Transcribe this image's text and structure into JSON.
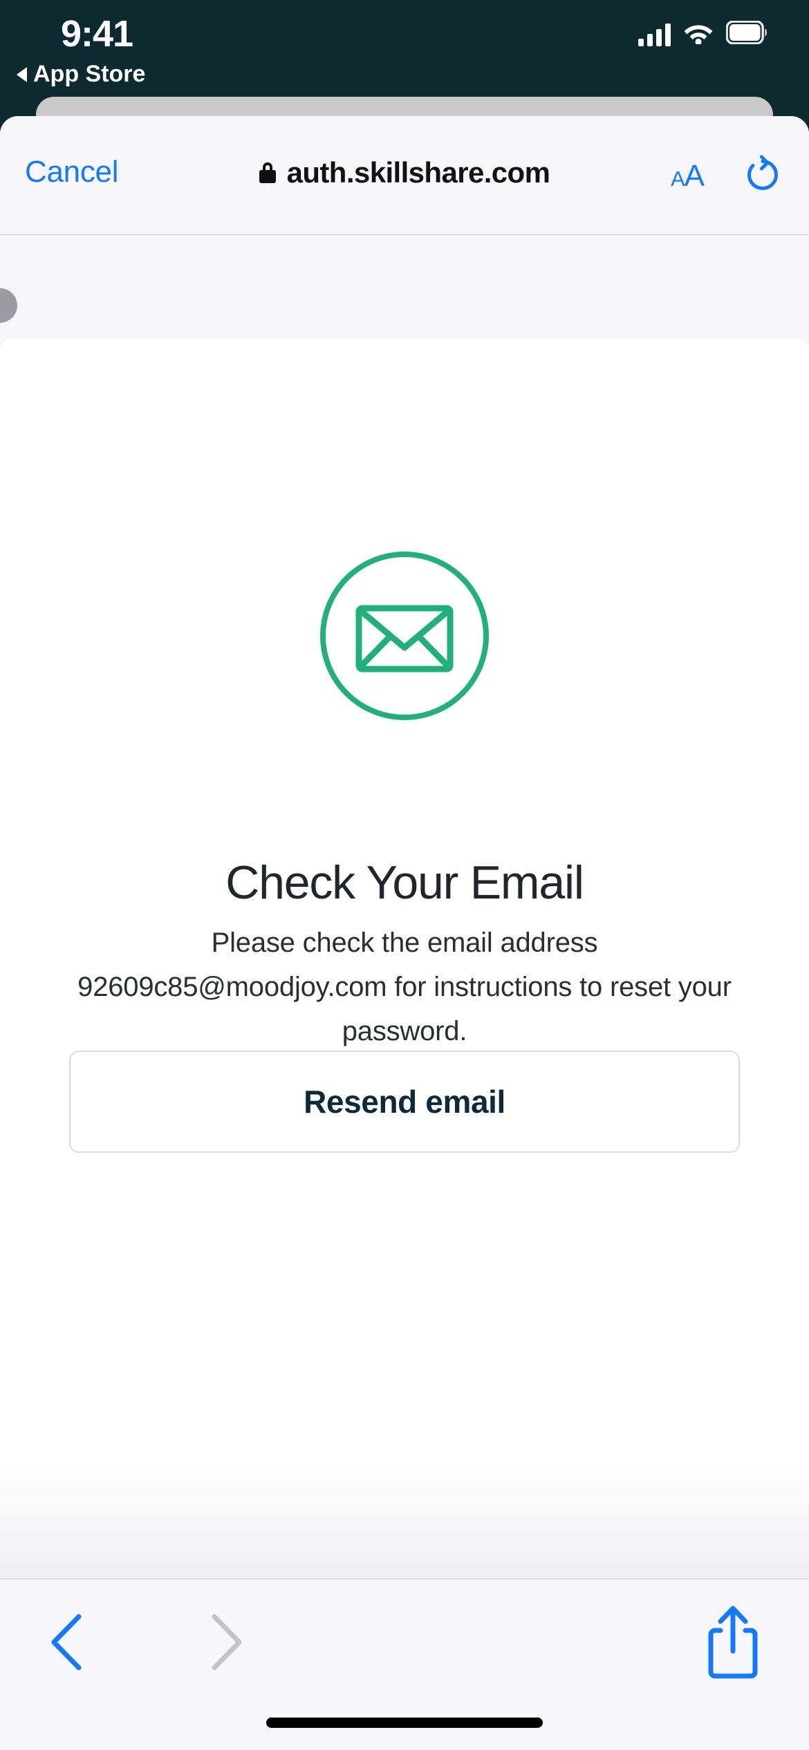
{
  "status_bar": {
    "time": "9:41",
    "back_app_label": "App Store",
    "back_triangle_icon": "triangle-left-icon",
    "signal_icon": "cellular-signal-icon",
    "wifi_icon": "wifi-icon",
    "battery_icon": "battery-full-icon",
    "background_color": "#0d2a30",
    "foreground_color": "#ffffff"
  },
  "browser": {
    "cancel_label": "Cancel",
    "lock_icon": "lock-icon",
    "url": "auth.skillshare.com",
    "text_size_small": "A",
    "text_size_large": "A",
    "reload_icon": "reload-icon",
    "accent_color": "#1479ff",
    "toolbar_background": "#f7f6f9"
  },
  "page": {
    "email_icon": "envelope-in-circle-icon",
    "icon_color": "#22b07a",
    "title": "Check Your Email",
    "body": "Please check the email address 92609c85@moodjoy.com for instructions to reset your password.",
    "email_address": "92609c85@moodjoy.com",
    "resend_label": "Resend email",
    "resend_text_color": "#0d2a3a",
    "background_color": "#ffffff"
  },
  "bottom_toolbar": {
    "back_icon": "chevron-left-icon",
    "forward_icon": "chevron-right-icon",
    "share_icon": "share-up-icon",
    "back_enabled_color": "#1479ff",
    "forward_disabled_color": "#c3c3c6",
    "share_color": "#1479ff"
  },
  "drag_bubble": {
    "icon": "drag-handle-circle",
    "color": "#9b9ba1"
  },
  "home_indicator": {
    "icon": "home-indicator",
    "color": "#000000"
  }
}
